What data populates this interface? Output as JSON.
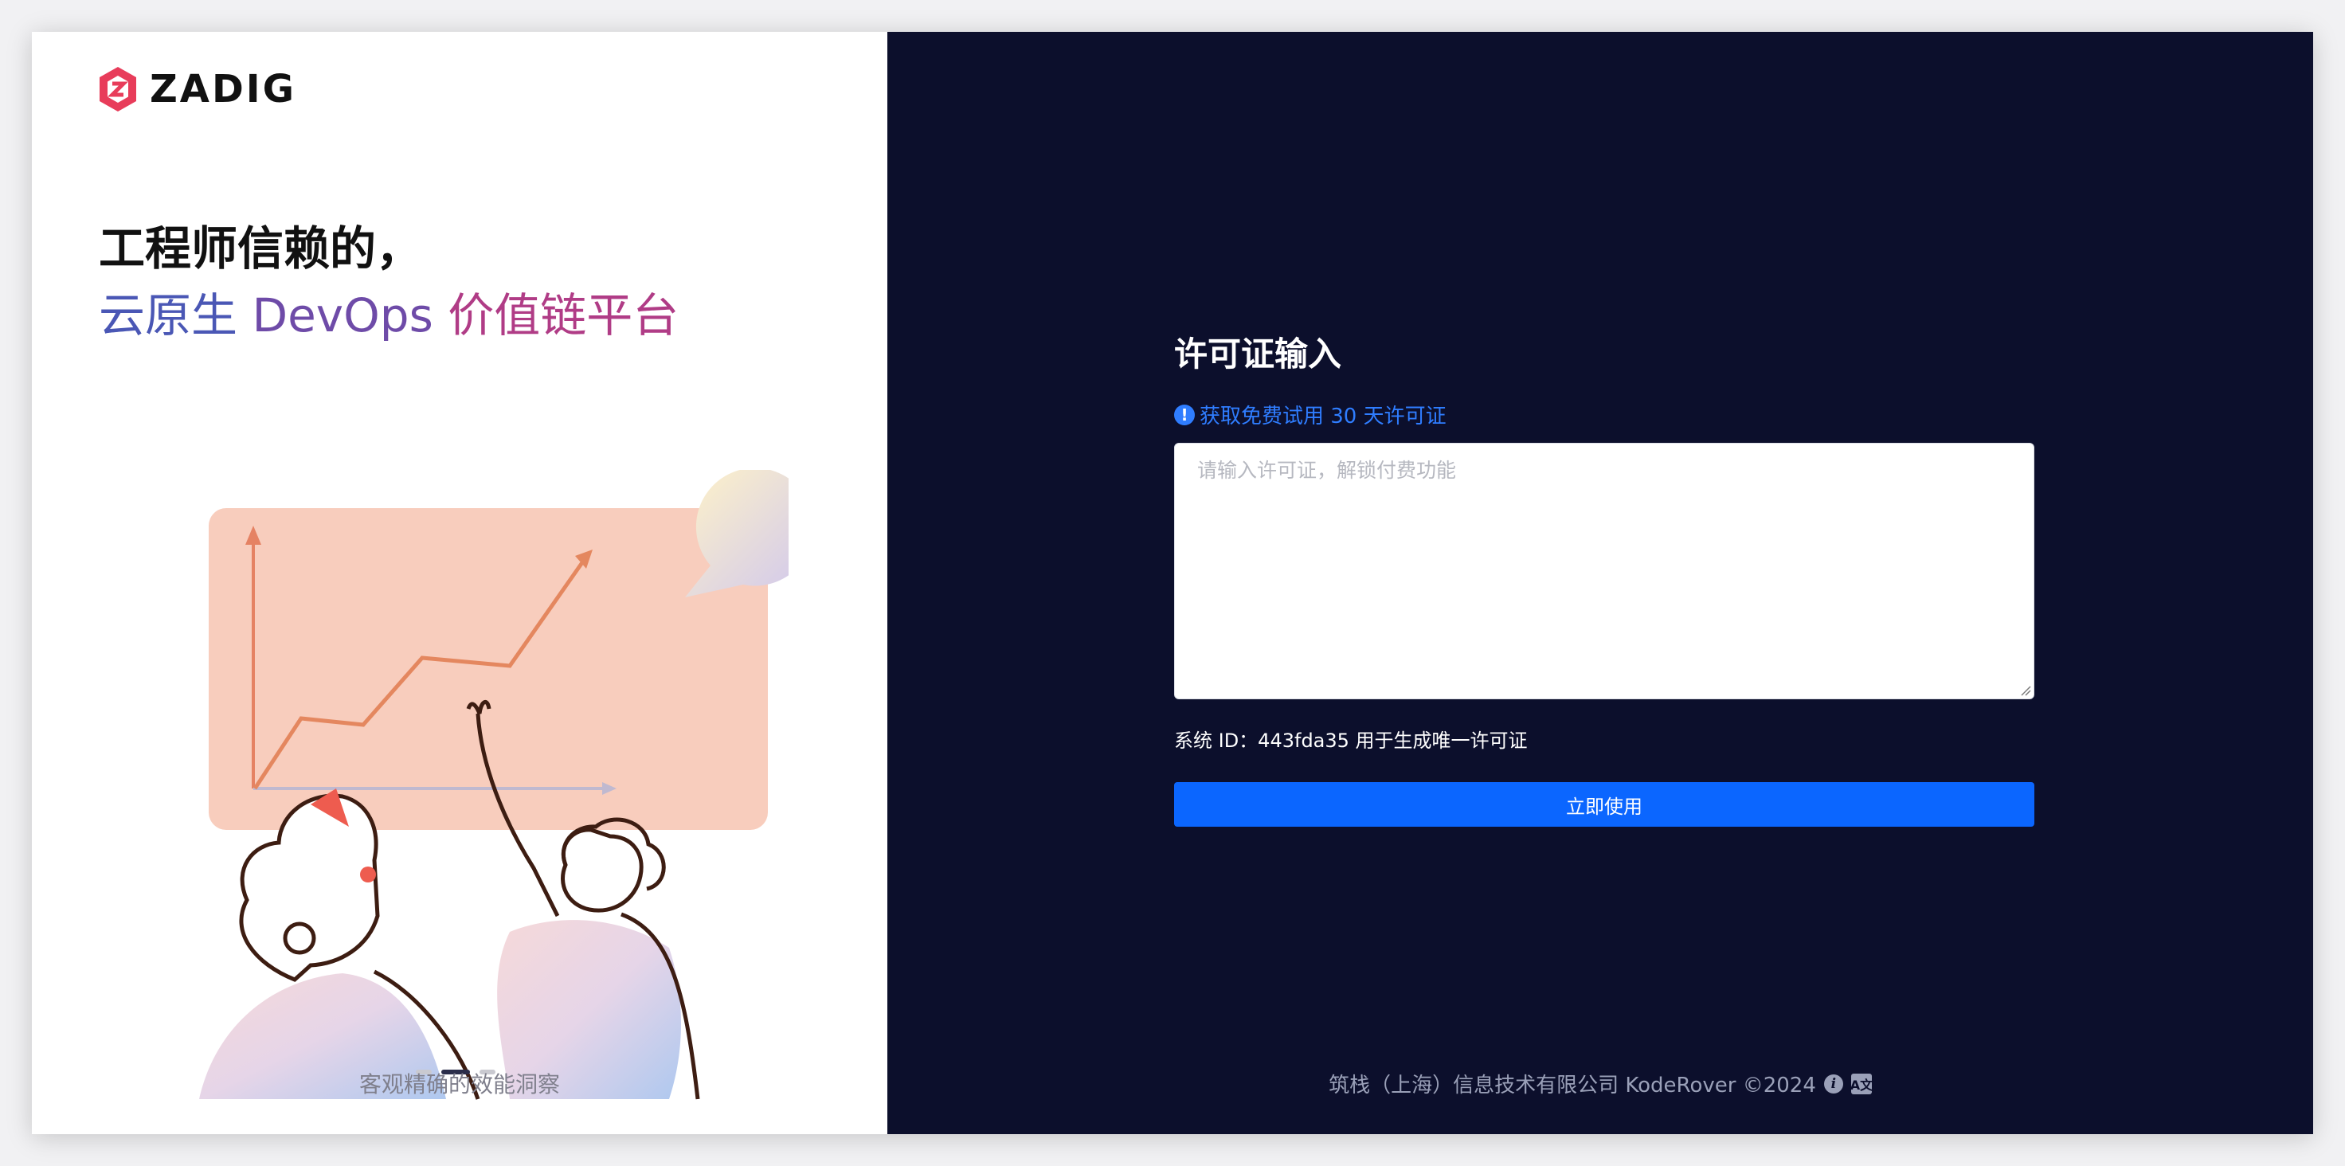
{
  "brand": {
    "logo_text": "ZADIG",
    "colors": {
      "logo": "#e83c5a",
      "panel_bg": "#0c0f2c",
      "accent": "#0b66ff",
      "link": "#2f7dff"
    }
  },
  "hero": {
    "line1": "工程师信赖的，",
    "line2_start": "云原生 ",
    "line2_mid": "DevOps ",
    "line2_end": "价值链平台",
    "caption": "客观精确的效能洞察"
  },
  "form": {
    "title": "许可证输入",
    "trial_link": "获取免费试用 30 天许可证",
    "license_placeholder": "请输入许可证，解锁付费功能",
    "license_value": "",
    "system_id_text": "系统 ID：443fda35 用于生成唯一许可证",
    "submit_label": "立即使用"
  },
  "footer": {
    "text": "筑栈（上海）信息技术有限公司 KodeRover ©2024",
    "info_icon": "i",
    "translate_icon": "A文"
  },
  "icons": {
    "logo": "zadig-logo-icon",
    "info": "info-circle-icon",
    "trial": "exclamation-circle-icon",
    "translate": "translate-icon"
  },
  "carousel": {
    "slide_count": 3,
    "active_index": 1
  }
}
